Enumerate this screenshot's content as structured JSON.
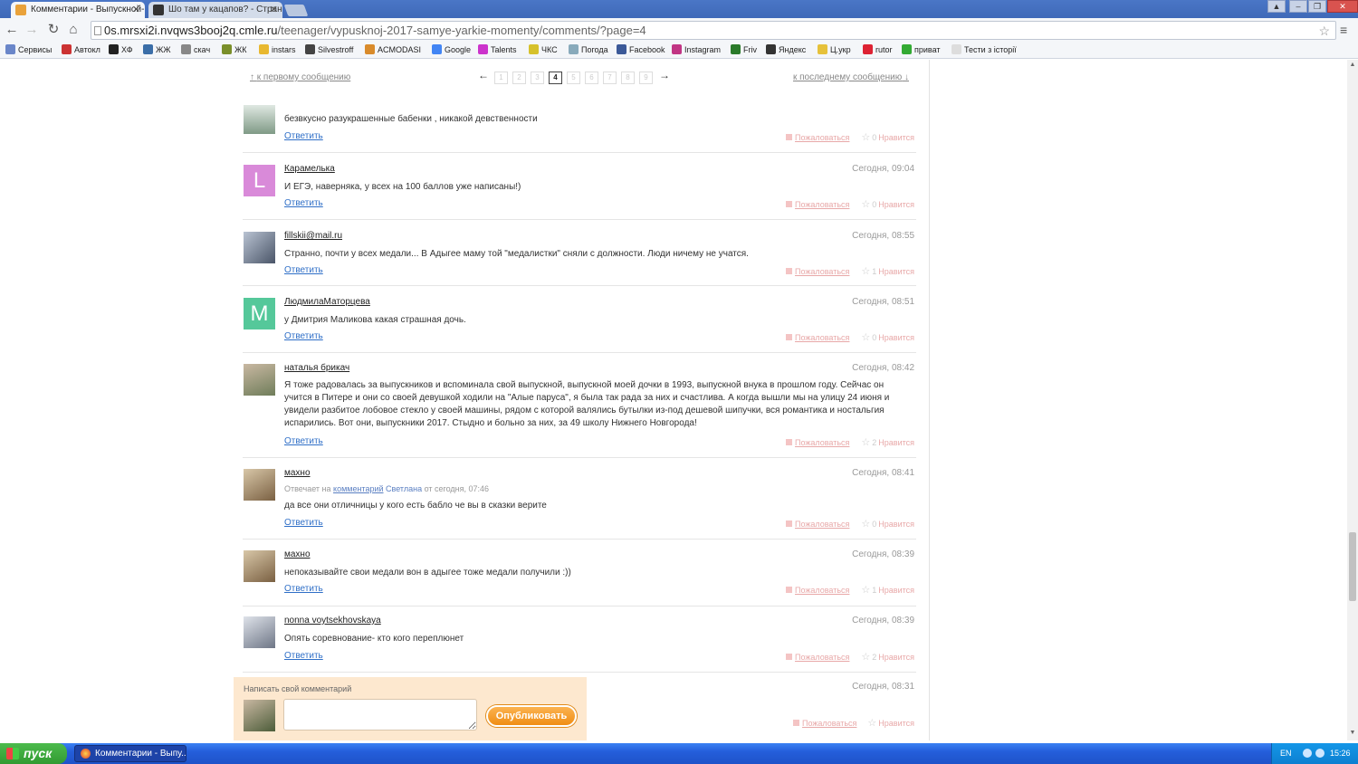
{
  "browser": {
    "tabs": [
      {
        "title": "Комментарии - Выпускной-",
        "active": true
      },
      {
        "title": "Шо там у кацапов? - Стран",
        "active": false
      }
    ],
    "url": {
      "host": "0s.mrsxi2i.nvqws3booj2q.cmle.ru",
      "path": "/teenager/vypusknoj-2017-samye-yarkie-momenty/comments/?page=4"
    },
    "bookmarks": [
      "Сервисы",
      "Автокл",
      "ХФ",
      "ЖЖ",
      "скач",
      "ЖК",
      "instars",
      "Silvestroff",
      "ACMODASI",
      "Google",
      "Talents",
      "ЧКС",
      "Погода",
      "Facebook",
      "Instagram",
      "Friv",
      "Яндекс",
      "Ц.укр",
      "rutor",
      "приват",
      "Тести з історії"
    ]
  },
  "pager": {
    "to_first": "к первому сообщению",
    "to_last": "к последнему сообщению",
    "prev": "←",
    "next": "→",
    "pages": [
      "1",
      "2",
      "3",
      "4",
      "5",
      "6",
      "7",
      "8",
      "9"
    ],
    "current": "4"
  },
  "labels": {
    "reply": "Ответить",
    "complain": "Пожаловаться",
    "like": "Нравится"
  },
  "comments": [
    {
      "author": "",
      "date": "",
      "text": "безвкусно разукрашенные бабенки , никакой девственности",
      "likes": "0"
    },
    {
      "author": "Карамелька",
      "avatar_letter": "L",
      "avatar_color": "#d98ad9",
      "date": "Сегодня, 09:04",
      "text": "И ЕГЭ, наверняка, у всех на 100 баллов уже написаны!)",
      "likes": "0"
    },
    {
      "author": "fillskii@mail.ru",
      "date": "Сегодня, 08:55",
      "text": "Странно, почти у всех медали... В Адыгее маму той \"медалистки\" сняли с должности. Люди ничему не учатся.",
      "likes": "1"
    },
    {
      "author": "ЛюдмилаМаторцева",
      "avatar_letter": "M",
      "avatar_color": "#55c89a",
      "date": "Сегодня, 08:51",
      "text": "у Дмитрия Маликова какая страшная дочь.",
      "likes": "0"
    },
    {
      "author": "наталья брикач",
      "date": "Сегодня, 08:42",
      "text": "Я тоже радовалась за выпускников и вспоминала свой выпускной, выпускной моей дочки в 1993, выпускной внука в прошлом году. Сейчас он учится в Питере и они со своей девушкой ходили на \"Алые паруса\", я была так рада за них и счастлива. А когда вышли мы на улицу 24 июня и увидели разбитое лобовое стекло у своей машины, рядом с которой валялись бутылки из-под дешевой шипучки, вся романтика и ностальгия испарились. Вот они, выпускники 2017. Стыдно и больно за них, за 49 школу Нижнего Новгорода!",
      "likes": "2"
    },
    {
      "author": "махно",
      "date": "Сегодня, 08:41",
      "reply_prefix": "Отвечает на",
      "reply_link": "комментарий",
      "reply_user": "Светлана",
      "reply_time": "от сегодня, 07:46",
      "text": "да все они отличницы у кого есть бабло че вы в сказки верите",
      "likes": "0"
    },
    {
      "author": "махно",
      "date": "Сегодня, 08:39",
      "text": "непоказывайте свои медали вон в адыгее тоже медали получили :))",
      "likes": "1"
    },
    {
      "author": "nonna voytsekhovskaya",
      "date": "Сегодня, 08:39",
      "text": "Опять соревнование- кто кого переплюнет",
      "likes": "2"
    },
    {
      "author": "",
      "date": "Сегодня, 08:31",
      "text": "",
      "likes": ""
    }
  ],
  "write": {
    "label": "Написать свой комментарий",
    "publish": "Опубликовать",
    "placeholder": ""
  },
  "taskbar": {
    "start": "пуск",
    "item": "Комментарии - Выпу...",
    "lang": "EN",
    "clock": "15:26"
  }
}
